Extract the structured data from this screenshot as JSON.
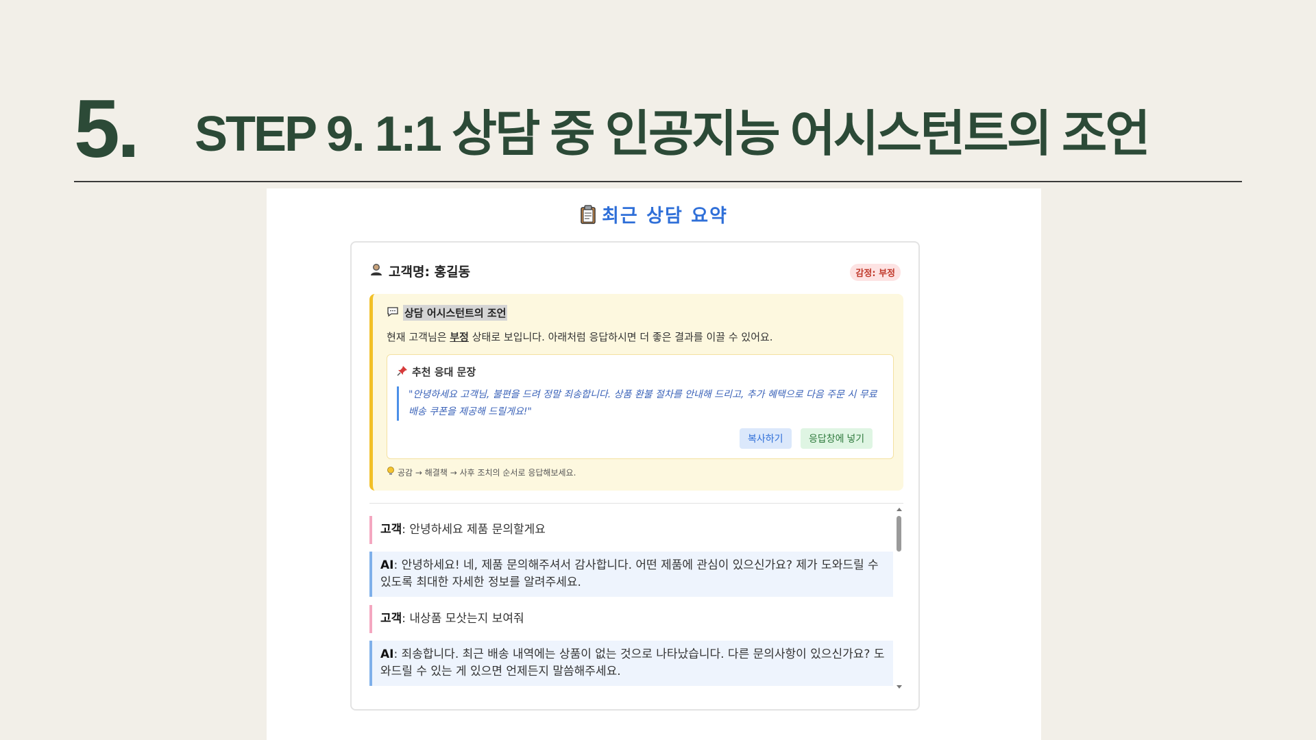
{
  "slide": {
    "number": "5.",
    "title": "STEP 9.  1:1 상담 중 인공지능 어시스턴트의 조언"
  },
  "panel": {
    "title": "최근 상담 요약",
    "title_icon": "clipboard-icon"
  },
  "customer": {
    "icon": "person-icon",
    "name_label": "고객명: 홍길동",
    "emotion_badge": "감정: 부정"
  },
  "advice": {
    "icon": "speech-bubble-icon",
    "heading": "상담 어시스턴트의 조언",
    "text_prefix": "현재 고객님은 ",
    "emotion": "부정",
    "text_suffix": " 상태로 보입니다. 아래처럼 응답하시면 더 좋은 결과를 이끌 수 있어요.",
    "recommend": {
      "icon": "pushpin-icon",
      "heading": "추천 응대 문장",
      "quote": "\"안녕하세요 고객님, 불편을 드려 정말 죄송합니다. 상품 환불 절차를 안내해 드리고, 추가 혜택으로 다음 주문 시 무료 배송 쿠폰을 제공해 드릴게요!\"",
      "copy_button": "복사하기",
      "insert_button": "응답창에 넣기"
    },
    "tip_icon": "lightbulb-icon",
    "tip": "공감 → 해결책 → 사후 조치의 순서로 응답해보세요."
  },
  "chat": {
    "messages": [
      {
        "speaker": "고객",
        "text": ": 안녕하세요 제품 문의할게요"
      },
      {
        "speaker": "AI",
        "text": ": 안녕하세요! 네, 제품 문의해주셔서 감사합니다. 어떤 제품에 관심이 있으신가요? 제가 도와드릴 수 있도록 최대한 자세한 정보를 알려주세요."
      },
      {
        "speaker": "고객",
        "text": ": 내상품 모삿는지 보여줘"
      },
      {
        "speaker": "AI",
        "text": ": 죄송합니다. 최근 배송 내역에는 상품이 없는 것으로 나타났습니다. 다른 문의사항이 있으신가요? 도와드릴 수 있는 게 있으면 언제든지 말씀해주세요."
      }
    ]
  },
  "colors": {
    "title_green": "#2c4a37",
    "accent_blue": "#2f6fd8",
    "advice_bg": "#fdf8df",
    "advice_border": "#f2c027",
    "customer_bar": "#f4a7c0",
    "ai_bar": "#7fb0ea",
    "ai_bg": "#eef4fd"
  }
}
